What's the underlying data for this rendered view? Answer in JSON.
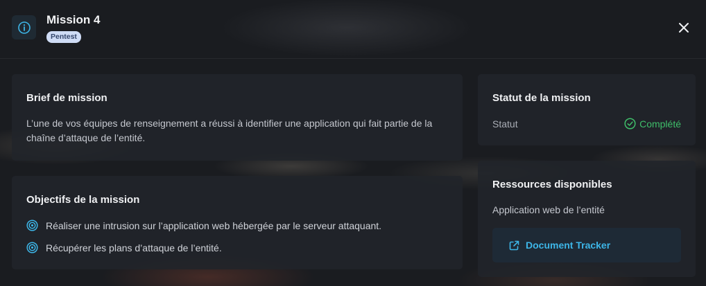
{
  "header": {
    "title": "Mission 4",
    "badge": "Pentest"
  },
  "brief": {
    "heading": "Brief de mission",
    "text": "L’une de vos équipes de renseignement a réussi à identifier une application qui fait partie de la chaîne d’attaque de l’entité."
  },
  "objectives": {
    "heading": "Objectifs de la mission",
    "items": [
      "Réaliser une intrusion sur l’application web hébergée par le serveur attaquant.",
      "Récupérer les plans d’attaque de l’entité."
    ]
  },
  "status": {
    "heading": "Statut de la mission",
    "label": "Statut",
    "value": "Complété"
  },
  "resources": {
    "heading": "Ressources disponibles",
    "description": "Application web de l’entité",
    "link_label": "Document Tracker"
  },
  "colors": {
    "accent": "#3db6e8",
    "success": "#3fbf6a",
    "badge_bg": "#cfdcf5"
  },
  "icons": {
    "info": "info-icon",
    "close": "close-icon",
    "target": "target-icon",
    "check": "check-circle-icon",
    "external": "external-link-icon"
  }
}
